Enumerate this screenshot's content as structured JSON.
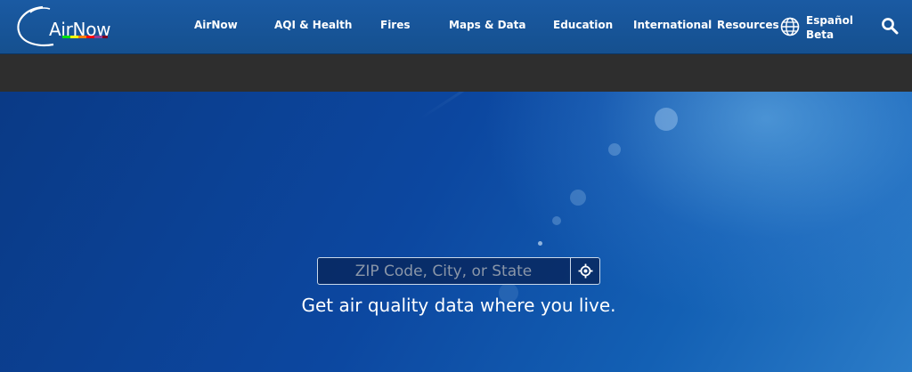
{
  "header": {
    "logo_text": "AirNow",
    "nav": [
      {
        "label": "AirNow"
      },
      {
        "label": "AQI & Health"
      },
      {
        "label": "Fires"
      },
      {
        "label": "Maps & Data"
      },
      {
        "label": "Education"
      },
      {
        "label": "International"
      },
      {
        "label": "Resources"
      }
    ],
    "language": {
      "line1": "Español",
      "line2": "Beta",
      "icon": "globe-icon"
    },
    "search_icon": "magnifier-icon"
  },
  "hero": {
    "search": {
      "value": "",
      "placeholder": "ZIP Code, City, or State",
      "locate_icon": "crosshair-locate-icon"
    },
    "tagline": "Get air quality data where you live."
  },
  "colors": {
    "header_bg": "#15508f",
    "subbar_bg": "#2e2e2e",
    "hero_bg": "#0c47a0",
    "text": "#ffffff"
  }
}
